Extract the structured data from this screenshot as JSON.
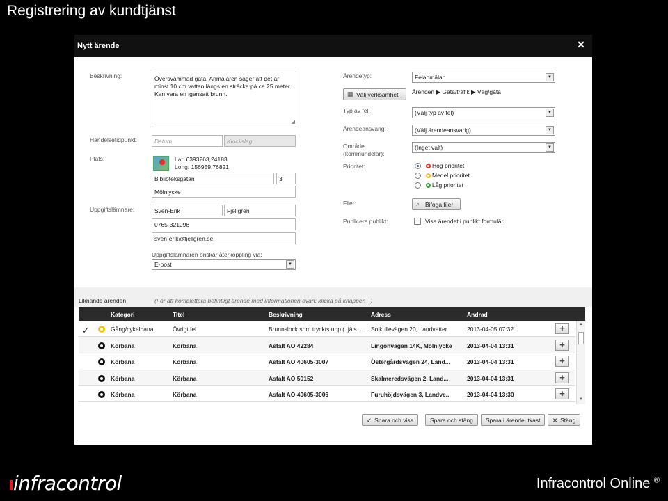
{
  "slide": {
    "title": "Registrering av kundtjänst",
    "logo_text": "infracontrol",
    "brand": "Infracontrol Online",
    "brand_mark": "®"
  },
  "dialog": {
    "title": "Nytt ärende",
    "close_glyph": "✕"
  },
  "form": {
    "beskrivning_label": "Beskrivning:",
    "beskrivning_text": "Översvämmad gata. Anmälaren säger att det är minst 10 cm vatten längs en sträcka på ca 25 meter. Kan vara en igensatt brunn.",
    "handelse_label": "Händelsetidpunkt:",
    "datum_placeholder": "Datum",
    "klockslag_placeholder": "Klockslag",
    "plats_label": "Plats:",
    "lat_label": "Lat:",
    "lat_value": "6393263,24183",
    "long_label": "Long:",
    "long_value": "156959,76821",
    "street": "Biblioteksgatan",
    "street_number": "3",
    "city": "Mölnlycke",
    "uppgift_label": "Uppgiftslämnare:",
    "first_name": "Sven-Erik",
    "last_name": "Fjellgren",
    "phone": "0765-321098",
    "email": "sven-erik@fjellgren.se",
    "feedback_label": "Uppgiftslämnaren önskar återkoppling via:",
    "feedback_value": "E-post",
    "arendetyp_label": "Ärendetyp:",
    "arendetyp_value": "Felanmälan",
    "valj_verksamhet": "Välj verksamhet",
    "breadcrumb": [
      "Ärenden",
      "Gata/trafik",
      "Väg/gata"
    ],
    "typ_label": "Typ av fel:",
    "typ_value": "(Välj typ av fel)",
    "ansvarig_label": "Ärendeansvarig:",
    "ansvarig_value": "(Välj ärendeansvarig)",
    "omrade_label_1": "Område",
    "omrade_label_2": "(kommundelar):",
    "omrade_value": "(Inget valt)",
    "prioritet_label": "Prioritet:",
    "priorities": [
      {
        "label": "Hög prioritet",
        "color": "#e03030",
        "selected": true
      },
      {
        "label": "Medel prioritet",
        "color": "#f2c318",
        "selected": false
      },
      {
        "label": "Låg prioritet",
        "color": "#3a9a3a",
        "selected": false
      }
    ],
    "filer_label": "Filer:",
    "bifoga": "Bifoga filer",
    "publicera_label": "Publicera publikt:",
    "publicera_check": "Visa ärendet i publikt formulär"
  },
  "similar": {
    "title": "Liknande ärenden",
    "hint": "(För att komplettera befintligt ärende med informationen ovan: klicka på knappen +)",
    "columns": [
      "Kategori",
      "Titel",
      "Beskrivning",
      "Adress",
      "Ändrad"
    ],
    "rows": [
      {
        "checked": "✓",
        "dot": "#f2c318",
        "kategori": "Gång/cykelbana",
        "titel": "Övrigt fel",
        "beskrivning": "Brunnslock som tryckts upp ( tjäls ...",
        "adress": "Solkullevägen 20, Landvetter",
        "andrad": "2013-04-05 07:32",
        "bold": false
      },
      {
        "checked": "",
        "dot": "#111111",
        "kategori": "Körbana",
        "titel": "Körbana",
        "beskrivning": "Asfalt AO 42284",
        "adress": "Lingonvägen 14K, Mölnlycke",
        "andrad": "2013-04-04 13:31",
        "bold": true
      },
      {
        "checked": "",
        "dot": "#111111",
        "kategori": "Körbana",
        "titel": "Körbana",
        "beskrivning": "Asfalt AO 40605-3007",
        "adress": "Östergårdsvägen 24, Land...",
        "andrad": "2013-04-04 13:31",
        "bold": true
      },
      {
        "checked": "",
        "dot": "#111111",
        "kategori": "Körbana",
        "titel": "Körbana",
        "beskrivning": "Asfalt AO 50152",
        "adress": "Skalmeredsvägen 2, Land...",
        "andrad": "2013-04-04 13:31",
        "bold": true
      },
      {
        "checked": "",
        "dot": "#111111",
        "kategori": "Körbana",
        "titel": "Körbana",
        "beskrivning": "Asfalt AO 40605-3006",
        "adress": "Furuhöjdsvägen 3, Landve...",
        "andrad": "2013-04-04 13:30",
        "bold": true
      }
    ],
    "plus_glyph": "+"
  },
  "footer": {
    "spara_visa": "Spara och visa",
    "spara_stang": "Spara och stäng",
    "spara_utkast": "Spara i ärendeutkast",
    "stang": "Stäng"
  }
}
